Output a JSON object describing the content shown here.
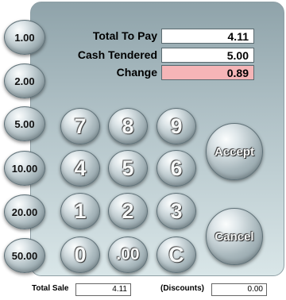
{
  "denominations": [
    "1.00",
    "2.00",
    "5.00",
    "10.00",
    "20.00",
    "50.00"
  ],
  "summary": {
    "total_to_pay_label": "Total To Pay",
    "total_to_pay_value": "4.11",
    "cash_tendered_label": "Cash Tendered",
    "cash_tendered_value": "5.00",
    "change_label": "Change",
    "change_value": "0.89"
  },
  "keypad": {
    "k7": "7",
    "k8": "8",
    "k9": "9",
    "k4": "4",
    "k5": "5",
    "k6": "6",
    "k1": "1",
    "k2": "2",
    "k3": "3",
    "k0": "0",
    "k00": ".00",
    "kclear": "C"
  },
  "actions": {
    "accept": "Accept",
    "cancel": "Cancel"
  },
  "footer": {
    "total_sale_label": "Total Sale",
    "total_sale_value": "4.11",
    "discounts_label": "(Discounts)",
    "discounts_value": "0.00"
  },
  "colors": {
    "change_bg": "#f5b5b7",
    "panel": "#b3c4c9"
  }
}
